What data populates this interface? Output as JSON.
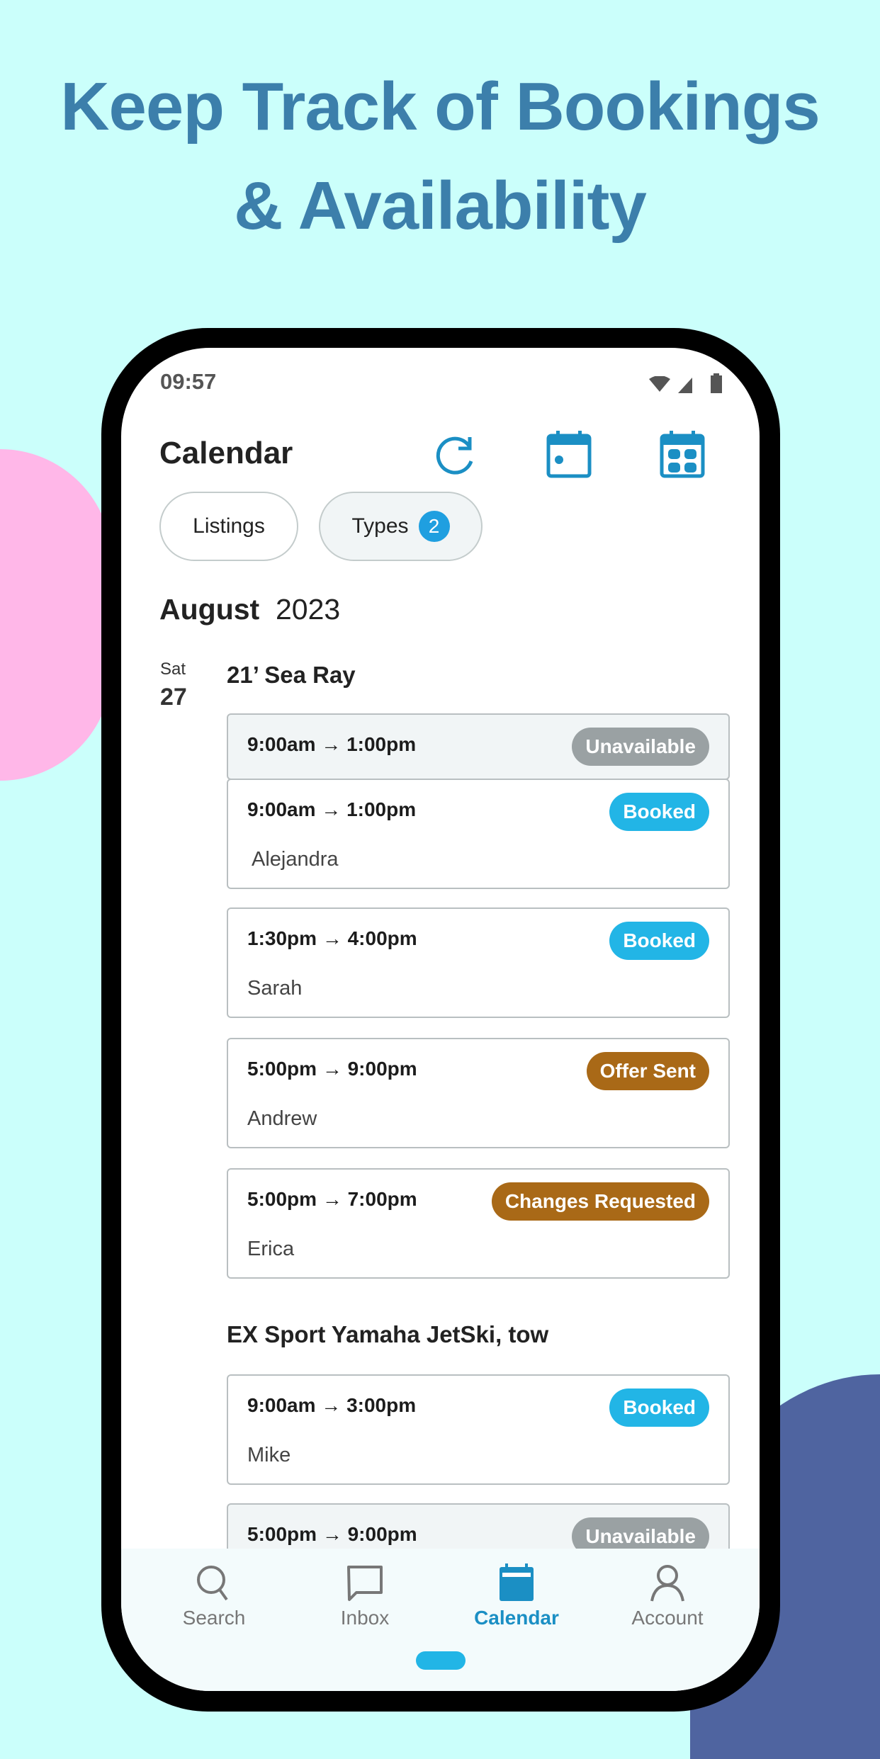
{
  "headline": {
    "line1": "Keep Track of Bookings",
    "line2": "& Availability"
  },
  "colors": {
    "background": "#cbfffb",
    "headline": "#3c7fab",
    "accent": "#1b8fc4",
    "booked": "#22b5e6",
    "offer": "#a96917",
    "unavailable": "#9aa1a3"
  },
  "status_bar": {
    "time": "09:57",
    "icons": [
      "wifi-icon",
      "signal-icon",
      "battery-icon"
    ]
  },
  "header": {
    "title": "Calendar",
    "icons": [
      "refresh-icon",
      "calendar-day-icon",
      "calendar-month-icon"
    ]
  },
  "filters": {
    "listings": "Listings",
    "types": "Types",
    "types_count": "2"
  },
  "month": {
    "name": "August",
    "year": "2023"
  },
  "day": {
    "weekday": "Sat",
    "date": "27"
  },
  "listings": [
    {
      "name": "21’ Sea Ray",
      "bookings": [
        {
          "time": "9:00am → 1:00pm",
          "status": "Unavailable",
          "guest": ""
        },
        {
          "time": "9:00am → 1:00pm",
          "status": "Booked",
          "guest": "Alejandra"
        },
        {
          "time": "1:30pm → 4:00pm",
          "status": "Booked",
          "guest": "Sarah"
        },
        {
          "time": "5:00pm → 9:00pm",
          "status": "Offer Sent",
          "guest": "Andrew"
        },
        {
          "time": "5:00pm → 7:00pm",
          "status": "Changes Requested",
          "guest": "Erica"
        }
      ]
    },
    {
      "name": "EX Sport Yamaha JetSki, tow",
      "bookings": [
        {
          "time": "9:00am → 3:00pm",
          "status": "Booked",
          "guest": "Mike"
        },
        {
          "time": "5:00pm → 9:00pm",
          "status": "Unavailable",
          "guest": ""
        }
      ]
    }
  ],
  "nav": [
    {
      "label": "Search",
      "icon": "search-icon"
    },
    {
      "label": "Inbox",
      "icon": "inbox-icon"
    },
    {
      "label": "Calendar",
      "icon": "calendar-icon",
      "active": true
    },
    {
      "label": "Account",
      "icon": "account-icon"
    }
  ]
}
